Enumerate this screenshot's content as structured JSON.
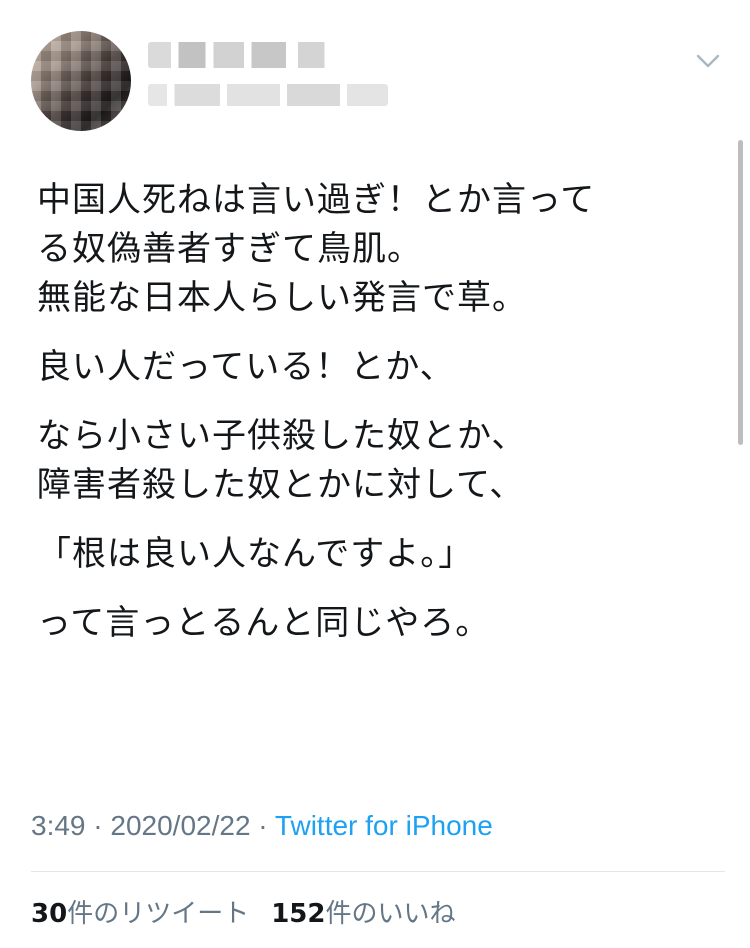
{
  "tweet": {
    "paragraphs": [
      [
        "中国人死ねは言い過ぎ！とか言って",
        "る奴偽善者すぎて鳥肌。",
        "無能な日本人らしい発言で草。"
      ],
      [
        "良い人だっている！とか、"
      ],
      [
        "なら小さい子供殺した奴とか、",
        "障害者殺した奴とかに対して、"
      ],
      [
        "「根は良い人なんですよ。」"
      ],
      [
        "って言っとるんと同じやろ。"
      ]
    ]
  },
  "meta": {
    "time": "3:49",
    "separator1": " · ",
    "date": "2020/02/22",
    "separator2": " · ",
    "source": "Twitter for iPhone"
  },
  "stats": {
    "retweets_count": "30",
    "retweets_label": "件のリツイート",
    "likes_count": "152",
    "likes_label": "件のいいね"
  },
  "icons": {
    "menu": "chevron-down-icon"
  }
}
